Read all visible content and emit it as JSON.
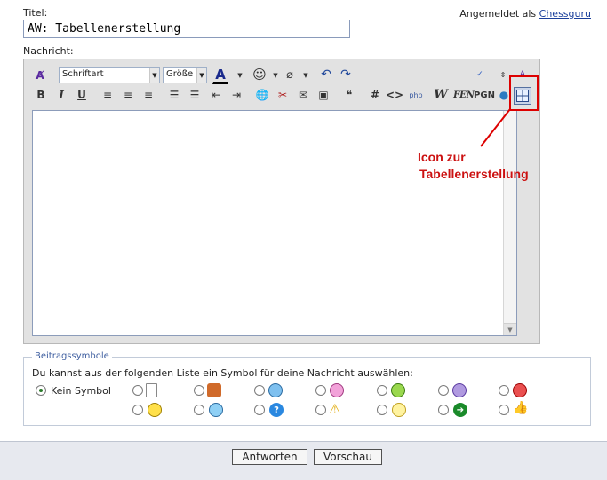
{
  "form": {
    "title_label": "Titel:",
    "title_value": "AW: Tabellenerstellung",
    "login_prefix": "Angemeldet als",
    "login_user": "Chessguru",
    "message_label": "Nachricht:"
  },
  "toolbar": {
    "font_select": "Schriftart",
    "size_select": "Größe",
    "format_bold": "B",
    "format_italic": "I",
    "format_underline": "U",
    "hash": "#",
    "code": "<>",
    "fen": "FEN",
    "pgn": "PGN"
  },
  "annotation": {
    "line1": "Icon zur",
    "line2": "Tabellenerstellung",
    "color": "#cc1111"
  },
  "symbols": {
    "legend": "Beitragssymbole",
    "description": "Du kannst aus der folgenden Liste ein Symbol für deine Nachricht auswählen:",
    "none_label": "Kein Symbol",
    "icons_row1": [
      "document-icon",
      "thumbs-down-icon",
      "smile-blue-icon",
      "smile-pink-icon",
      "grin-green-icon",
      "sad-purple-icon",
      "angry-red-icon"
    ],
    "icons_row2": [
      "smile-yellow-icon",
      "cool-icon",
      "question-icon",
      "warning-icon",
      "lightbulb-icon",
      "arrow-right-icon",
      "thumbs-up-icon"
    ]
  },
  "buttons": {
    "reply": "Antworten",
    "preview": "Vorschau"
  }
}
